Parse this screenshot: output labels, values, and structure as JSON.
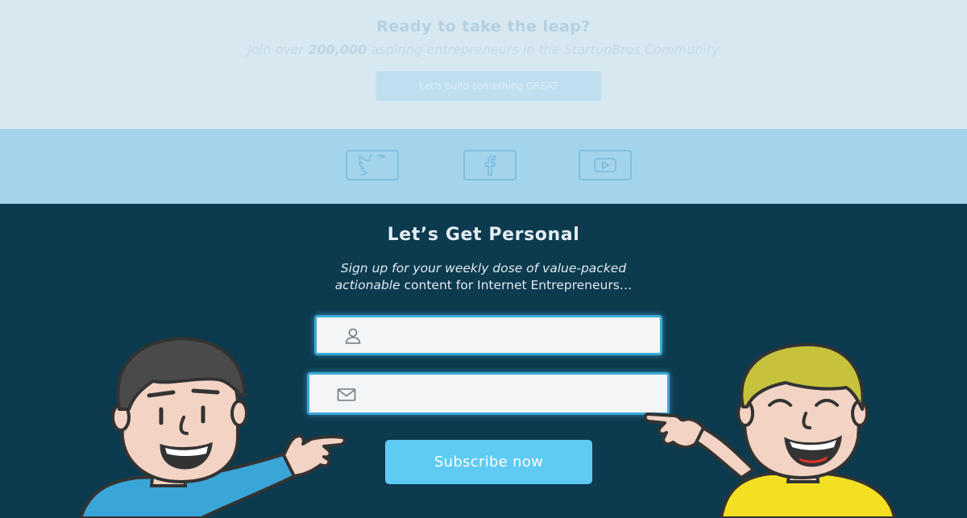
{
  "top_section": {
    "title": "Ready to take the leap?",
    "subtitle_prefix": "Join over ",
    "subtitle_number": "200,000",
    "subtitle_suffix": " aspiring entrepreneurs in the StartupBros Community",
    "cta_label": "Let's build something GREAT"
  },
  "social": {
    "items": [
      {
        "name": "twitter-icon"
      },
      {
        "name": "facebook-icon"
      },
      {
        "name": "youtube-icon"
      }
    ]
  },
  "signup": {
    "title": "Let’s Get Personal",
    "subtitle_line1": "Sign up for your weekly dose of value-packed",
    "subtitle_line2_em": "actionable",
    "subtitle_line2_rest": " content for Internet Entrepreneurs…",
    "name_value": "",
    "email_value": "",
    "subscribe_label": "Subscribe now"
  },
  "colors": {
    "accent": "#5fcaf3",
    "dark_bg": "#0c3a4e",
    "social_bg": "#a4d4ec"
  }
}
